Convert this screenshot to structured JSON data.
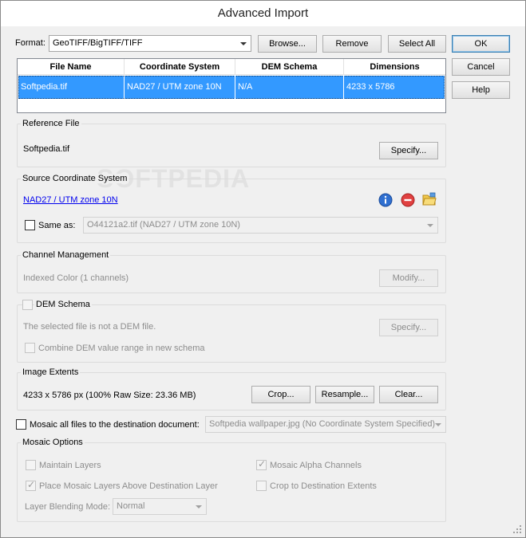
{
  "window": {
    "title": "Advanced Import"
  },
  "format": {
    "label": "Format:",
    "value": "GeoTIFF/BigTIFF/TIFF",
    "browse": "Browse...",
    "remove": "Remove",
    "select_all": "Select All"
  },
  "dialog_buttons": {
    "ok": "OK",
    "cancel": "Cancel",
    "help": "Help"
  },
  "table": {
    "columns": [
      "File Name",
      "Coordinate System",
      "DEM Schema",
      "Dimensions"
    ],
    "rows": [
      [
        "Softpedia.tif",
        "NAD27 / UTM zone 10N",
        "N/A",
        "4233 x 5786"
      ]
    ]
  },
  "reference_file": {
    "title": "Reference File",
    "file": "Softpedia.tif",
    "specify": "Specify..."
  },
  "source_cs": {
    "title": "Source Coordinate System",
    "link": "NAD27 / UTM zone 10N",
    "same_as_label": "Same as:",
    "same_as_value": "O44121a2.tif (NAD27 / UTM zone 10N)"
  },
  "channel": {
    "title": "Channel Management",
    "info": "Indexed Color (1 channels)",
    "modify": "Modify..."
  },
  "dem": {
    "title": "DEM Schema",
    "info": "The selected file is not a DEM file.",
    "specify": "Specify...",
    "combine": "Combine DEM value range in new schema"
  },
  "extents": {
    "title": "Image Extents",
    "info": "4233 x 5786 px (100% Raw Size: 23.36 MB)",
    "crop": "Crop...",
    "resample": "Resample...",
    "clear": "Clear..."
  },
  "mosaic": {
    "checkbox_label": "Mosaic all files to the destination document:",
    "destination": "Softpedia wallpaper.jpg (No Coordinate System Specified)"
  },
  "mosaic_options": {
    "title": "Mosaic Options",
    "maintain_layers": "Maintain Layers",
    "alpha_channels": "Mosaic Alpha Channels",
    "place_above": "Place Mosaic Layers Above Destination Layer",
    "crop_dest": "Crop to Destination Extents",
    "blend_label": "Layer Blending Mode:",
    "blend_value": "Normal"
  },
  "watermark": "SOFTPEDIA",
  "colors": {
    "selection": "#3399ff",
    "link": "#0000ee",
    "default_border": "#3c7fb1"
  }
}
